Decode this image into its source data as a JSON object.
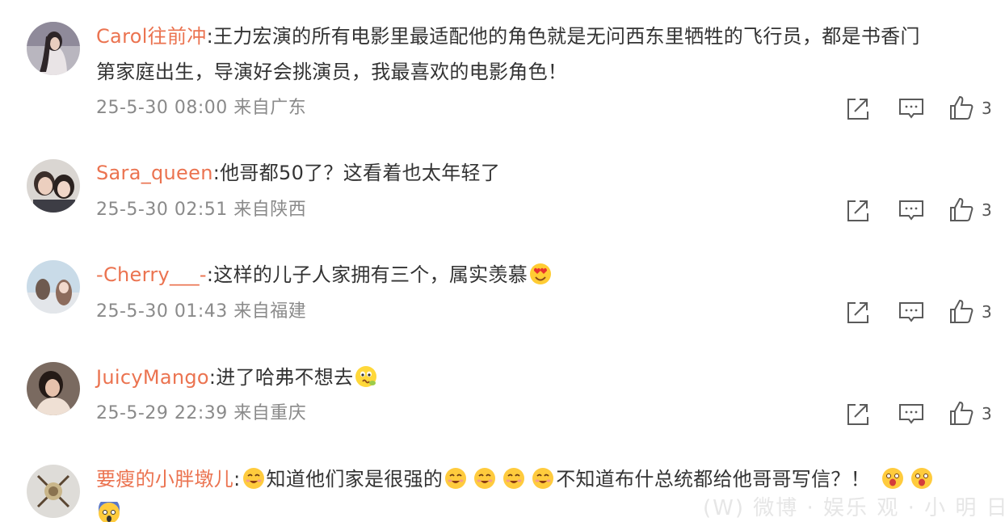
{
  "colors": {
    "username": "#eb7350",
    "body_text": "#333333",
    "meta_text": "#8a8a8a",
    "icon": "#5a5a5a",
    "background": "#ffffff"
  },
  "comments": [
    {
      "username": "Carol往前冲",
      "separator": ":",
      "lines": [
        "王力宏演的所有电影里最适配他的角色就是无问西东里牺牲的飞行员，都是书香门",
        "第家庭出生，导演好会挑演员，我最喜欢的电影角色！"
      ],
      "timestamp": "25-5-30 08:00",
      "location": "来自广东",
      "like_count": "3",
      "avatar_icon": "avatar-photo"
    },
    {
      "username": "Sara_queen",
      "separator": ":",
      "lines": [
        "他哥都50了？这看着也太年轻了"
      ],
      "timestamp": "25-5-30 02:51",
      "location": "来自陕西",
      "like_count": "3",
      "avatar_icon": "avatar-photo"
    },
    {
      "username": "-Cherry___-",
      "separator": ":",
      "lines": [
        "这样的儿子人家拥有三个，属实羡慕"
      ],
      "trailing_emoji": "heart-eyes-emoji",
      "timestamp": "25-5-30 01:43",
      "location": "来自福建",
      "like_count": "3",
      "avatar_icon": "avatar-photo"
    },
    {
      "username": "JuicyMango",
      "separator": ":",
      "lines": [
        "进了哈弗不想去"
      ],
      "trailing_emoji": "sour-face-emoji",
      "timestamp": "25-5-29 22:39",
      "location": "来自重庆",
      "like_count": "3",
      "avatar_icon": "avatar-photo"
    },
    {
      "username": "要瘦的小胖墩儿",
      "separator": ":",
      "segments": [
        "知道他们家是很强的",
        "不知道布什总统都给他哥哥写信？！"
      ],
      "emoji_names": [
        "grin-emoji",
        "shocked-emoji",
        "scream-emoji"
      ],
      "avatar_icon": "avatar-photo"
    }
  ],
  "action_icons": {
    "share": "share-icon",
    "comment": "comment-icon",
    "like": "thumbs-up-icon"
  },
  "watermark": "(W) 微博 · 娱乐 观 · 小 明 日 报"
}
